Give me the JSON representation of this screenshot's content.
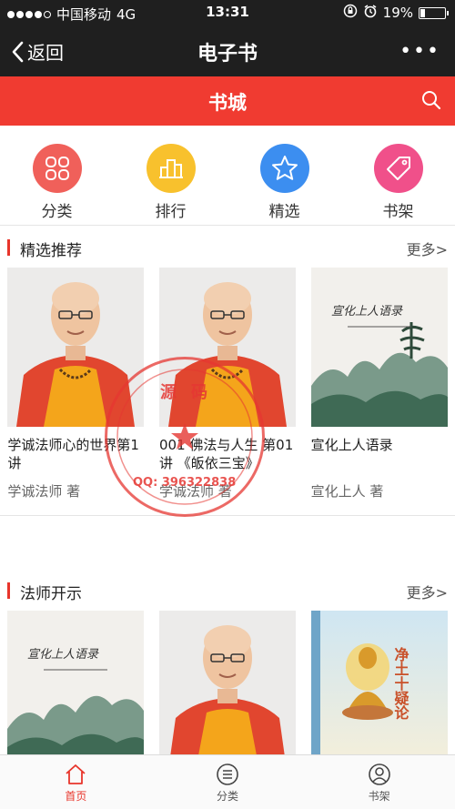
{
  "status": {
    "carrier": "中国移动",
    "network": "4G",
    "time": "13:31",
    "battery": "19%",
    "battery_level": 0.19
  },
  "nav": {
    "back_label": "返回",
    "title": "电子书",
    "more_label": "•••"
  },
  "store": {
    "title": "书城"
  },
  "categories": [
    {
      "label": "分类",
      "icon": "grid-icon",
      "color": "#f0605a"
    },
    {
      "label": "排行",
      "icon": "ranking-icon",
      "color": "#f8c12d"
    },
    {
      "label": "精选",
      "icon": "star-icon",
      "color": "#3c8ef0"
    },
    {
      "label": "书架",
      "icon": "tag-icon",
      "color": "#f0508a"
    }
  ],
  "sections": [
    {
      "title": "精选推荐",
      "more": "更多>",
      "books": [
        {
          "title": "学诚法师心的世界第1讲",
          "author": "学诚法师 著",
          "cover": "monk-portrait"
        },
        {
          "title": "001 佛法与人生 第01讲 《皈依三宝》",
          "author": "学诚法师 著",
          "cover": "monk-portrait"
        },
        {
          "title": "宣化上人语录",
          "author": "宣化上人 著",
          "cover": "landscape-book",
          "cover_text": "宣化上人语录"
        }
      ]
    },
    {
      "title": "法师开示",
      "more": "更多>",
      "books": [
        {
          "cover": "landscape-book",
          "cover_text": "宣化上人语录"
        },
        {
          "cover": "monk-portrait"
        },
        {
          "cover": "buddha-book",
          "cover_text": "净土十疑论"
        }
      ]
    }
  ],
  "stamp": {
    "top_text": "源码",
    "qq": "QQ: 396322838"
  },
  "tabs": [
    {
      "label": "首页",
      "icon": "home-icon",
      "active": true
    },
    {
      "label": "分类",
      "icon": "list-icon",
      "active": false
    },
    {
      "label": "书架",
      "icon": "user-icon",
      "active": false
    }
  ]
}
